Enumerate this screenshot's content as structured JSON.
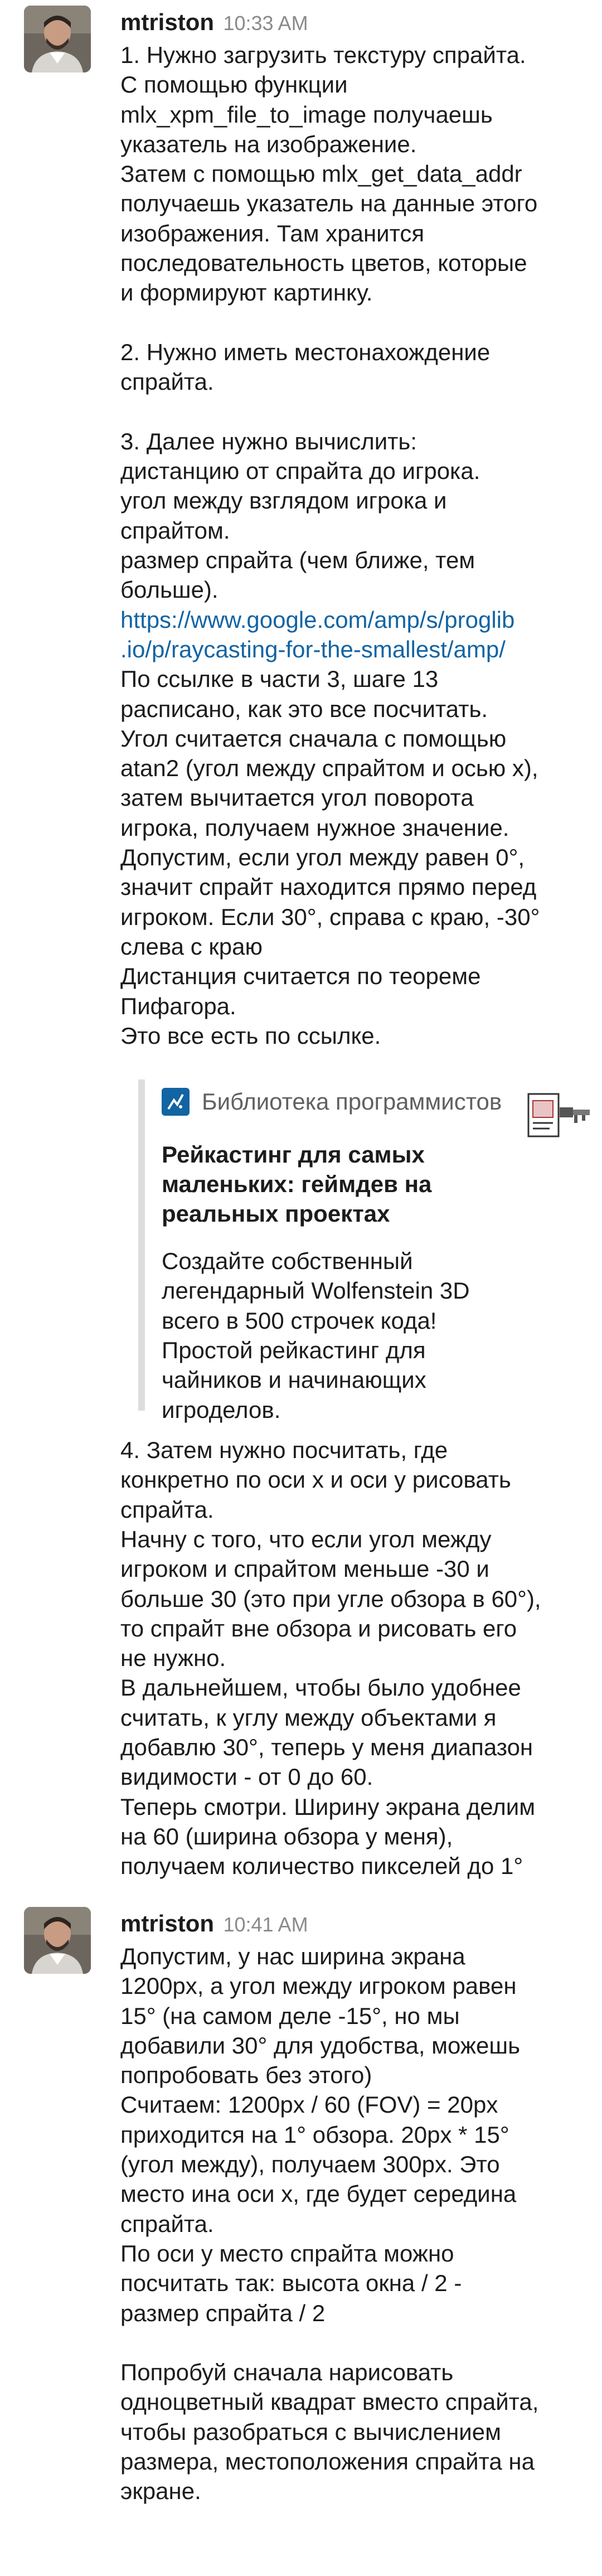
{
  "messages": [
    {
      "author": "mtriston",
      "time": "10:33 AM",
      "text_before": "1. Нужно загрузить текстуру спрайта.\nС помощью функции\nmlx_xpm_file_to_image получаешь\nуказатель на изображение.\nЗатем с помощью mlx_get_data_addr\nполучаешь указатель на данные этого\nизображения. Там хранится\nпоследовательность цветов, которые\nи формируют картинку.\n\n2. Нужно иметь местонахождение\nспрайта.\n\n3. Далее нужно вычислить:\nдистанцию от спрайта до игрока.\nугол между взглядом игрока и\nспрайтом.\nразмер спрайта (чем ближе, тем\nбольше).",
      "link": "https://www.google.com/amp/s/proglib\n.io/p/raycasting-for-the-smallest/amp/",
      "text_after_link": "По ссылке в части 3, шаге 13\nрасписано, как это все посчитать.\nУгол считается сначала с помощью\natan2 (угол между спрайтом и осью x),\nзатем вычитается угол поворота\nигрока, получаем нужное значение.\nДопустим, если угол между равен 0°,\nзначит спрайт находится прямо перед\nигроком. Если 30°, справа с краю, -30°\nслева с краю\nДистанция считается по теореме\nПифагора.\nЭто все есть по ссылке.",
      "unfurl": {
        "site": "Библиотека программистов",
        "title": "Рейкастинг для самых\nмаленьких: геймдев на\nреальных проектах",
        "description": "Создайте собственный\nлегендарный Wolfenstein 3D\nвсего в 500 строчек кода!\nПростой рейкастинг для\nчайников и начинающих\nигроделов."
      },
      "text_final": "4. Затем нужно посчитать, где\nконкретно по оси x и оси y рисовать\nспрайта.\nНачну с того, что если угол между\nигроком и спрайтом меньше -30 и\nбольше 30 (это при угле обзора в 60°),\nто спрайт вне обзора и рисовать его\nне нужно.\nВ дальнейшем, чтобы было удобнее\nсчитать, к углу между объектами я\nдобавлю 30°, теперь у меня диапазон\nвидимости - от 0 до 60.\nТеперь смотри. Ширину экрана делим\nна 60 (ширина обзора у меня),\nполучаем количество пикселей до 1°"
    },
    {
      "author": "mtriston",
      "time": "10:41 AM",
      "text": "Допустим, у нас ширина экрана\n1200px, а угол между игроком равен\n15° (на самом деле -15°, но мы\nдобавили 30° для удобства, можешь\nпопробовать без этого)\nСчитаем: 1200px / 60 (FOV) = 20px\nприходится на 1° обзора. 20px * 15°\n(угол между), получаем 300px. Это\nместо ина оси x, где будет середина\nспрайта.\nПо оси y место спрайта можно\nпосчитать так: высота окна / 2 -\nразмер спрайта / 2\n\nПопробуй сначала нарисовать\nодноцветный квадрат вместо спрайта,\nчтобы разобраться с вычислением\nразмера, местоположения спрайта на\nэкране."
    }
  ]
}
